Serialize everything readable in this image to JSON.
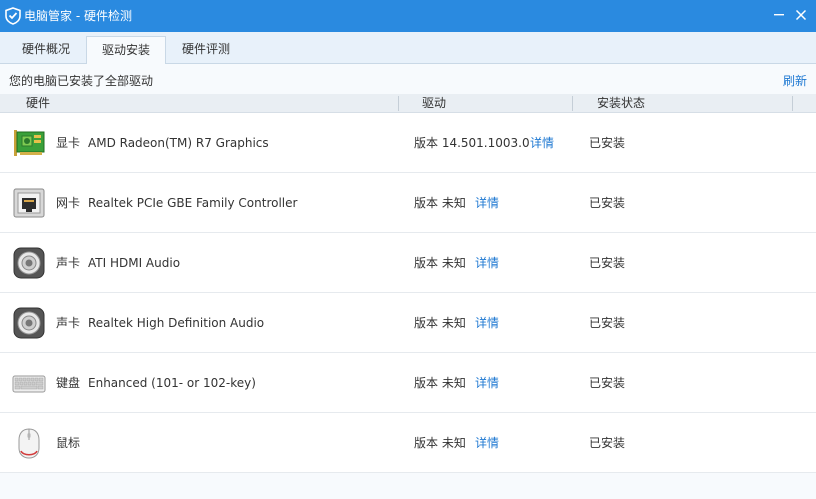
{
  "window": {
    "title": "电脑管家 - 硬件检测"
  },
  "tabs": [
    {
      "label": "硬件概况"
    },
    {
      "label": "驱动安装"
    },
    {
      "label": "硬件评测"
    }
  ],
  "status": {
    "message": "您的电脑已安装了全部驱动",
    "refresh_label": "刷新"
  },
  "table": {
    "headers": [
      "硬件",
      "驱动",
      "安装状态"
    ],
    "rows": [
      {
        "icon": "graphics-card-icon",
        "category": "显卡",
        "name": "AMD Radeon(TM) R7 Graphics",
        "version": "版本 14.501.1003.0",
        "detail": "详情",
        "status": "已安装"
      },
      {
        "icon": "network-card-icon",
        "category": "网卡",
        "name": "Realtek PCIe GBE Family Controller",
        "version": "版本 未知",
        "detail": "详情",
        "status": "已安装"
      },
      {
        "icon": "speaker-icon",
        "category": "声卡",
        "name": "ATI HDMI Audio",
        "version": "版本 未知",
        "detail": "详情",
        "status": "已安装"
      },
      {
        "icon": "speaker-icon",
        "category": "声卡",
        "name": "Realtek High Definition Audio",
        "version": "版本 未知",
        "detail": "详情",
        "status": "已安装"
      },
      {
        "icon": "keyboard-icon",
        "category": "键盘",
        "name": "Enhanced (101- or 102-key)",
        "version": "版本 未知",
        "detail": "详情",
        "status": "已安装"
      },
      {
        "icon": "mouse-icon",
        "category": "鼠标",
        "name": "",
        "version": "版本 未知",
        "detail": "详情",
        "status": "已安装"
      }
    ]
  },
  "colors": {
    "titlebar": "#2a8ae0",
    "link": "#1e78d2"
  }
}
